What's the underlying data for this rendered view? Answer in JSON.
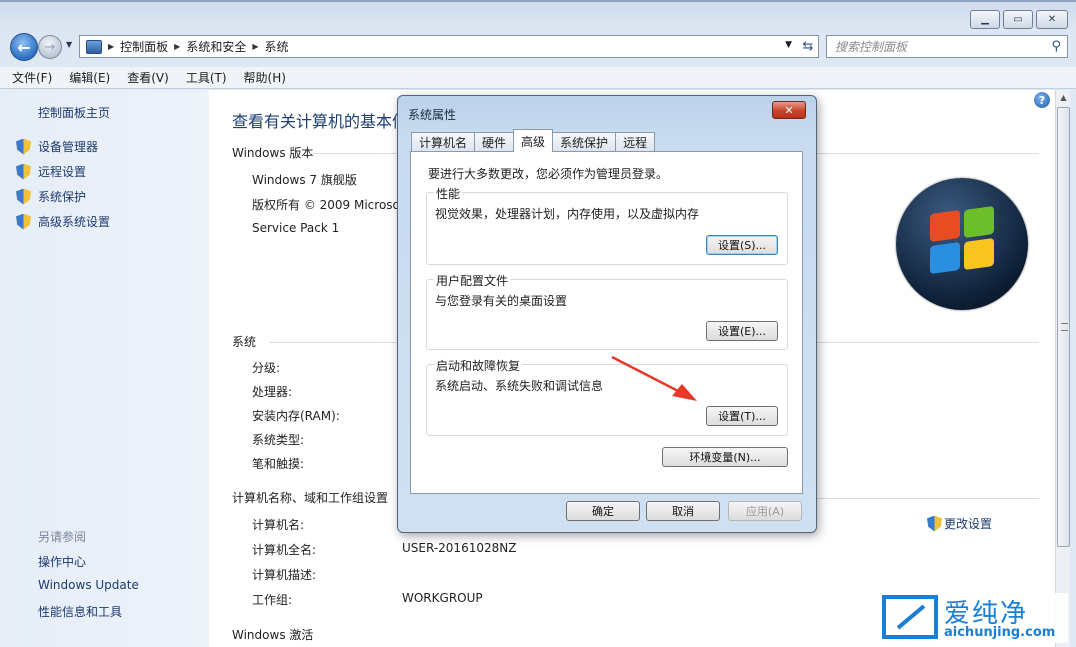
{
  "window": {
    "controls": {
      "min": "▁",
      "max": "▭",
      "close": "✕"
    }
  },
  "address": {
    "crumbs": [
      "控制面板",
      "系统和安全",
      "系统"
    ],
    "search_placeholder": "搜索控制面板"
  },
  "menu": [
    "文件(F)",
    "编辑(E)",
    "查看(V)",
    "工具(T)",
    "帮助(H)"
  ],
  "left": {
    "home": "控制面板主页",
    "links": [
      "设备管理器",
      "远程设置",
      "系统保护",
      "高级系统设置"
    ],
    "see_also_title": "另请参阅",
    "see_also": [
      "操作中心",
      "Windows Update",
      "性能信息和工具"
    ]
  },
  "main": {
    "title": "查看有关计算机的基本信",
    "edition_header": "Windows 版本",
    "edition": "Windows 7 旗舰版",
    "copyright": "版权所有 © 2009 Microso",
    "service_pack": "Service Pack 1",
    "system_header": "系统",
    "system_labels": [
      "分级:",
      "处理器:",
      "安装内存(RAM):",
      "系统类型:",
      "笔和触摸:"
    ],
    "computer_header": "计算机名称、域和工作组设置",
    "computer_labels": [
      "计算机名:",
      "计算机全名:",
      "计算机描述:",
      "工作组:"
    ],
    "full_name": "USER-20161028NZ",
    "workgroup": "WORKGROUP",
    "change_settings": "更改设置",
    "activation_header": "Windows 激活",
    "help": "?"
  },
  "dialog": {
    "title": "系统属性",
    "close": "✕",
    "tabs": [
      "计算机名",
      "硬件",
      "高级",
      "系统保护",
      "远程"
    ],
    "active_tab": "高级",
    "admin_note": "要进行大多数更改，您必须作为管理员登录。",
    "performance": {
      "title": "性能",
      "desc": "视觉效果，处理器计划，内存使用，以及虚拟内存",
      "button": "设置(S)..."
    },
    "profiles": {
      "title": "用户配置文件",
      "desc": "与您登录有关的桌面设置",
      "button": "设置(E)..."
    },
    "startup": {
      "title": "启动和故障恢复",
      "desc": "系统启动、系统失败和调试信息",
      "button": "设置(T)..."
    },
    "env_button": "环境变量(N)...",
    "ok": "确定",
    "cancel": "取消",
    "apply": "应用(A)"
  },
  "watermark": {
    "text": "爱纯净",
    "url": "aichunjing.com"
  },
  "colors": {
    "arrow": "#e8382a",
    "link": "#1e3a6e",
    "title": "#1d3f73"
  }
}
